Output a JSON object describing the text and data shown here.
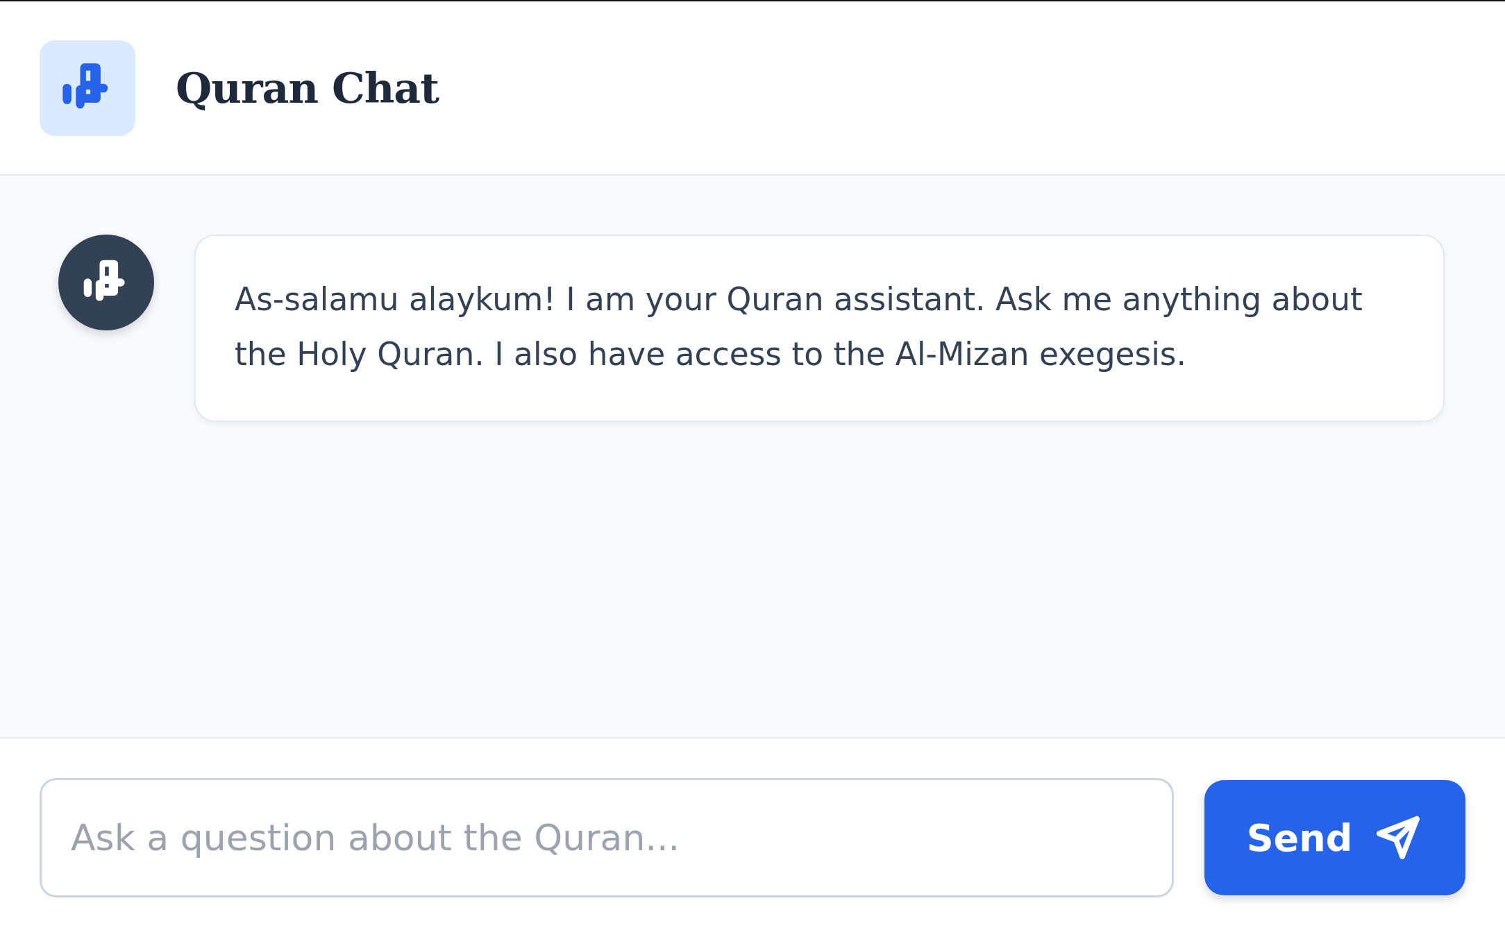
{
  "header": {
    "title": "Quran Chat"
  },
  "messages": [
    {
      "kind": "assistant",
      "text": "As-salamu alaykum! I am your Quran assistant. Ask me anything about the Holy Quran. I also have access to the Al-Mizan exegesis."
    }
  ],
  "composer": {
    "placeholder": "Ask a question about the Quran...",
    "button": "Send"
  }
}
